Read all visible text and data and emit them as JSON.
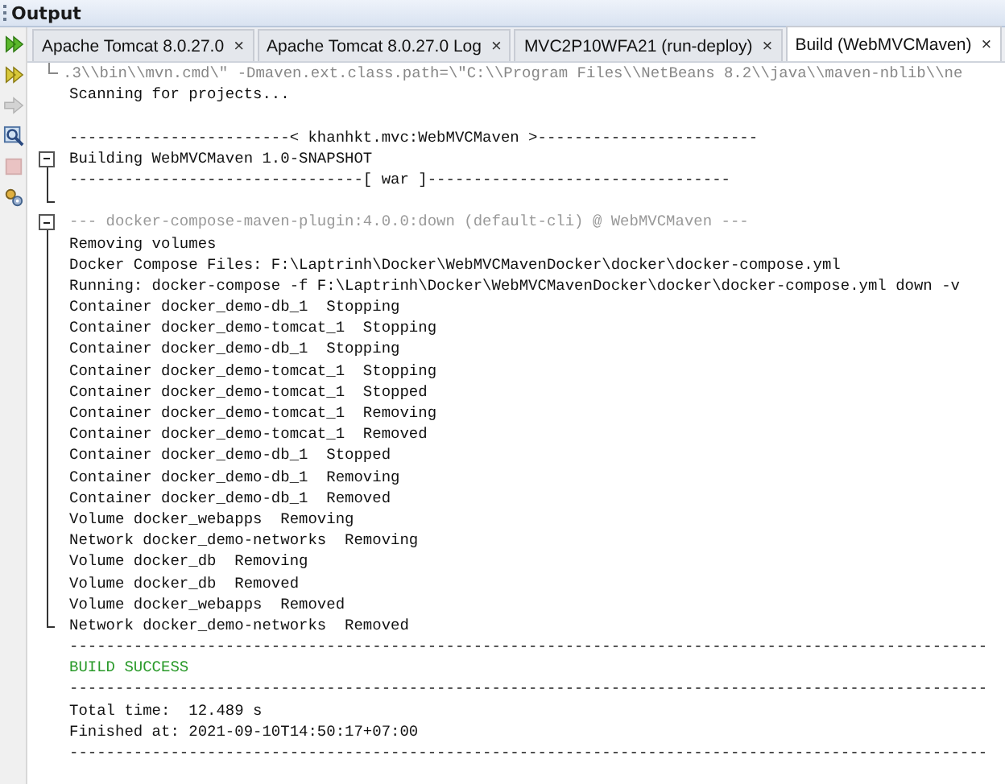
{
  "panel": {
    "title": "Output"
  },
  "tabs": [
    {
      "label": "Apache Tomcat 8.0.27.0",
      "selected": false,
      "close": "×"
    },
    {
      "label": "Apache Tomcat 8.0.27.0 Log",
      "selected": false,
      "close": "×"
    },
    {
      "label": "MVC2P10WFA21 (run-deploy)",
      "selected": false,
      "close": "×"
    },
    {
      "label": "Build (WebMVCMaven)",
      "selected": true,
      "close": "×"
    }
  ],
  "toolbar": [
    {
      "kind": "rerun",
      "disabled": false
    },
    {
      "kind": "rerun-goals",
      "disabled": false
    },
    {
      "kind": "resume",
      "disabled": true
    },
    {
      "kind": "inspect",
      "disabled": false
    },
    {
      "kind": "stop",
      "disabled": true
    },
    {
      "kind": "settings",
      "disabled": false
    }
  ],
  "blocks": [
    {
      "kind": "tail",
      "lines": [
        {
          "kind": "command",
          "text": ".3\\\\bin\\\\mvn.cmd\\\" -Dmaven.ext.class.path=\\\"C:\\\\Program Files\\\\NetBeans 8.2\\\\java\\\\maven-nblib\\\\ne"
        }
      ]
    },
    {
      "kind": "plain",
      "lines": [
        {
          "kind": "plain",
          "text": "Scanning for projects..."
        },
        {
          "kind": "blank"
        },
        {
          "kind": "plain",
          "text": "------------------------< khanhkt.mvc:WebMVCMaven >------------------------"
        }
      ]
    },
    {
      "kind": "fold",
      "expanded": true,
      "lines": [
        {
          "kind": "plain",
          "text": "Building WebMVCMaven 1.0-SNAPSHOT"
        },
        {
          "kind": "plain",
          "text": "--------------------------------[ war ]---------------------------------"
        },
        {
          "kind": "blank"
        }
      ]
    },
    {
      "kind": "fold",
      "expanded": true,
      "lines": [
        {
          "kind": "comment",
          "text": "--- docker-compose-maven-plugin:4.0.0:down (default-cli) @ WebMVCMaven ---"
        },
        {
          "kind": "plain",
          "text": "Removing volumes"
        },
        {
          "kind": "plain",
          "text": "Docker Compose Files: F:\\Laptrinh\\Docker\\WebMVCMavenDocker\\docker\\docker-compose.yml"
        },
        {
          "kind": "plain",
          "text": "Running: docker-compose -f F:\\Laptrinh\\Docker\\WebMVCMavenDocker\\docker\\docker-compose.yml down -v"
        },
        {
          "kind": "plain",
          "text": "Container docker_demo-db_1  Stopping"
        },
        {
          "kind": "plain",
          "text": "Container docker_demo-tomcat_1  Stopping"
        },
        {
          "kind": "plain",
          "text": "Container docker_demo-db_1  Stopping"
        },
        {
          "kind": "plain",
          "text": "Container docker_demo-tomcat_1  Stopping"
        },
        {
          "kind": "plain",
          "text": "Container docker_demo-tomcat_1  Stopped"
        },
        {
          "kind": "plain",
          "text": "Container docker_demo-tomcat_1  Removing"
        },
        {
          "kind": "plain",
          "text": "Container docker_demo-tomcat_1  Removed"
        },
        {
          "kind": "plain",
          "text": "Container docker_demo-db_1  Stopped"
        },
        {
          "kind": "plain",
          "text": "Container docker_demo-db_1  Removing"
        },
        {
          "kind": "plain",
          "text": "Container docker_demo-db_1  Removed"
        },
        {
          "kind": "plain",
          "text": "Volume docker_webapps  Removing"
        },
        {
          "kind": "plain",
          "text": "Network docker_demo-networks  Removing"
        },
        {
          "kind": "plain",
          "text": "Volume docker_db  Removing"
        },
        {
          "kind": "plain",
          "text": "Volume docker_db  Removed"
        },
        {
          "kind": "plain",
          "text": "Volume docker_webapps  Removed"
        },
        {
          "kind": "plain",
          "text": "Network docker_demo-networks  Removed"
        }
      ]
    },
    {
      "kind": "plain",
      "lines": [
        {
          "kind": "plain",
          "text": "----------------------------------------------------------------------------------------------------"
        },
        {
          "kind": "success",
          "text": "BUILD SUCCESS"
        },
        {
          "kind": "plain",
          "text": "----------------------------------------------------------------------------------------------------"
        },
        {
          "kind": "plain",
          "text": "Total time:  12.489 s"
        },
        {
          "kind": "plain",
          "text": "Finished at: 2021-09-10T14:50:17+07:00"
        },
        {
          "kind": "plain",
          "text": "----------------------------------------------------------------------------------------------------"
        }
      ]
    }
  ]
}
